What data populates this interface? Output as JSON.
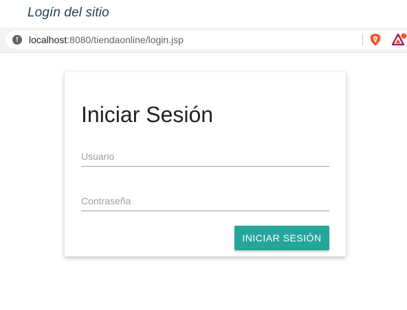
{
  "caption": "Logín del sitio",
  "browser": {
    "url_host": "localhost",
    "url_rest": ":8080/tiendaonline/login.jsp",
    "info_icon": "info-icon",
    "extensions": [
      "brave-shield-icon",
      "bat-rewards-icon"
    ]
  },
  "login": {
    "title": "Iniciar Sesión",
    "username_placeholder": "Usuario",
    "username_value": "",
    "password_placeholder": "Contraseña",
    "password_value": "",
    "submit_label": "INICIAR SESIÓN"
  },
  "colors": {
    "button": "#26a69a",
    "caption": "#1f3f5b",
    "brave": "#fb542b",
    "bat": "#9e1f63"
  }
}
